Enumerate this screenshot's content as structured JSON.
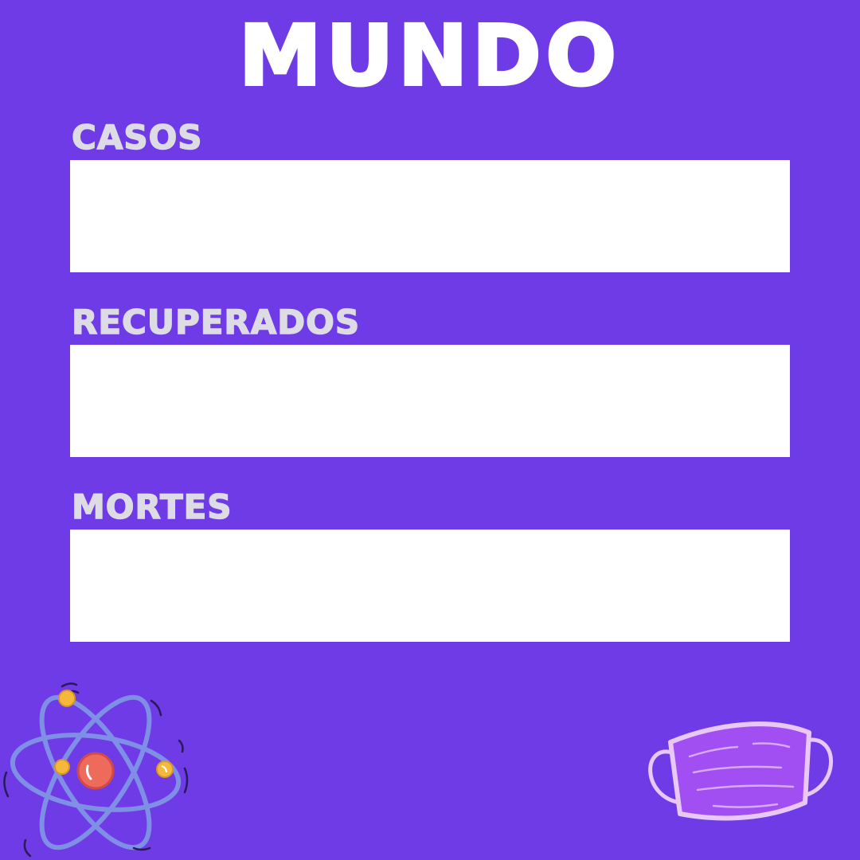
{
  "header": {
    "title": "MUNDO"
  },
  "stats": [
    {
      "label": "CASOS",
      "value": ""
    },
    {
      "label": "RECUPERADOS",
      "value": ""
    },
    {
      "label": "MORTES",
      "value": ""
    }
  ],
  "colors": {
    "background": "#6e3be6",
    "title": "#ffffff",
    "label": "#dddbe4",
    "field": "#ffffff",
    "atom_orbit": "#7f8fe6",
    "atom_nucleus": "#ee6a5a",
    "atom_electron": "#f4b93a",
    "mask_body": "#a14ef2",
    "mask_outline": "#e9c8f5"
  },
  "decorations": {
    "atom": "atom-icon",
    "mask": "face-mask-icon"
  }
}
